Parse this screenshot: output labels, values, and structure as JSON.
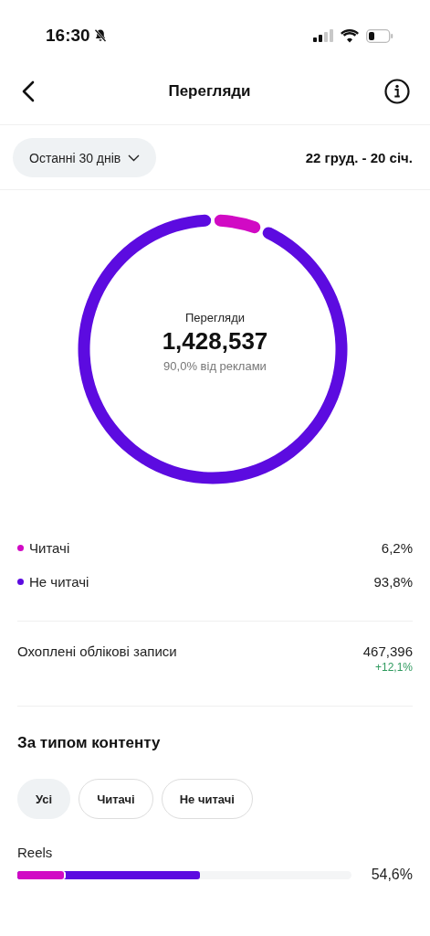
{
  "status_bar": {
    "time": "16:30",
    "silent": true
  },
  "header": {
    "title": "Перегляди"
  },
  "filter": {
    "period": "Останні 30 днів",
    "range": "22 груд. - 20 січ."
  },
  "summary": {
    "label": "Перегляди",
    "total": "1,428,537",
    "note": "90,0% від реклами",
    "chart_data": {
      "type": "donut",
      "values": [
        6.2,
        93.8
      ]
    }
  },
  "legend": [
    {
      "label": "Читачі",
      "value": "6,2%",
      "color": "#d10ac4"
    },
    {
      "label": "Не читачі",
      "value": "93,8%",
      "color": "#5c0be0"
    }
  ],
  "reach": {
    "label": "Охоплені облікові записи",
    "value": "467,396",
    "change": "+12,1%"
  },
  "content_type": {
    "title": "За типом контенту",
    "chips": [
      {
        "label": "Усі",
        "selected": true
      },
      {
        "label": "Читачі",
        "selected": false
      },
      {
        "label": "Не читачі",
        "selected": false
      }
    ],
    "rows": [
      {
        "label": "Reels",
        "value": "54,6%",
        "segments": [
          {
            "level": 0.139,
            "color": "#d10ac4"
          },
          {
            "level": 0.546,
            "color": "#5c0be0"
          }
        ]
      }
    ]
  }
}
